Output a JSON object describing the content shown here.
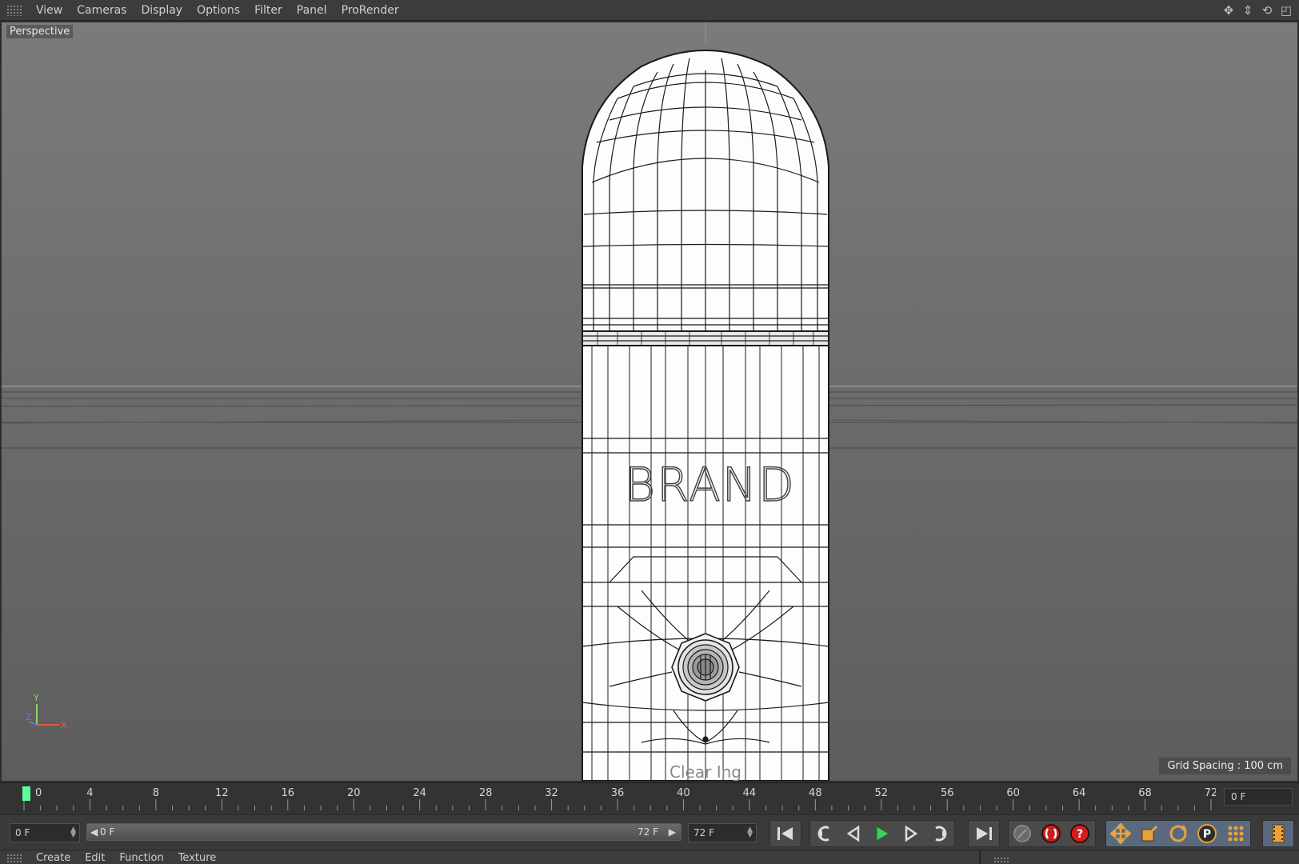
{
  "menubar": {
    "items": [
      "View",
      "Cameras",
      "Display",
      "Options",
      "Filter",
      "Panel",
      "ProRender"
    ],
    "icons": [
      "move-view-icon",
      "pan-view-icon",
      "rotate-view-icon",
      "toggle-layout-icon"
    ]
  },
  "viewport": {
    "camera_label": "Perspective",
    "grid_spacing": "Grid Spacing : 100 cm",
    "model_label_main": "BRAND",
    "model_label_small": "Clear Ing",
    "axis_labels": {
      "y": "Y",
      "z": "Z",
      "x": "X"
    },
    "colors": {
      "background_top": "#7b7b7b",
      "background_bottom": "#5d5d5d",
      "wire": "#1a1a1a",
      "axis_y": "#8ed46a",
      "axis_x": "#e05a3a",
      "axis_z": "#5a7fe0"
    }
  },
  "timeline": {
    "tick_labels": [
      "0",
      "4",
      "8",
      "12",
      "16",
      "20",
      "24",
      "28",
      "32",
      "36",
      "40",
      "44",
      "48",
      "52",
      "56",
      "60",
      "64",
      "68",
      "72"
    ],
    "current_frame": 0,
    "max_frame": 72,
    "current_frame_field": "0 F",
    "playhead_color": "#5cff9a"
  },
  "transport": {
    "start_field": "0 F",
    "range_start": "0 F",
    "range_end": "72 F",
    "end_field": "72 F",
    "buttons": [
      "go-to-start",
      "previous-key",
      "previous-frame",
      "play-forward",
      "next-frame",
      "next-key",
      "go-to-end",
      "record-active-objects",
      "autokeying",
      "keyframe-selection",
      "record-position",
      "record-scale",
      "record-rotation",
      "record-parameter",
      "record-point-level",
      "scheme-settings"
    ]
  },
  "bottombar": {
    "items": [
      "Create",
      "Edit",
      "Function",
      "Texture"
    ]
  }
}
